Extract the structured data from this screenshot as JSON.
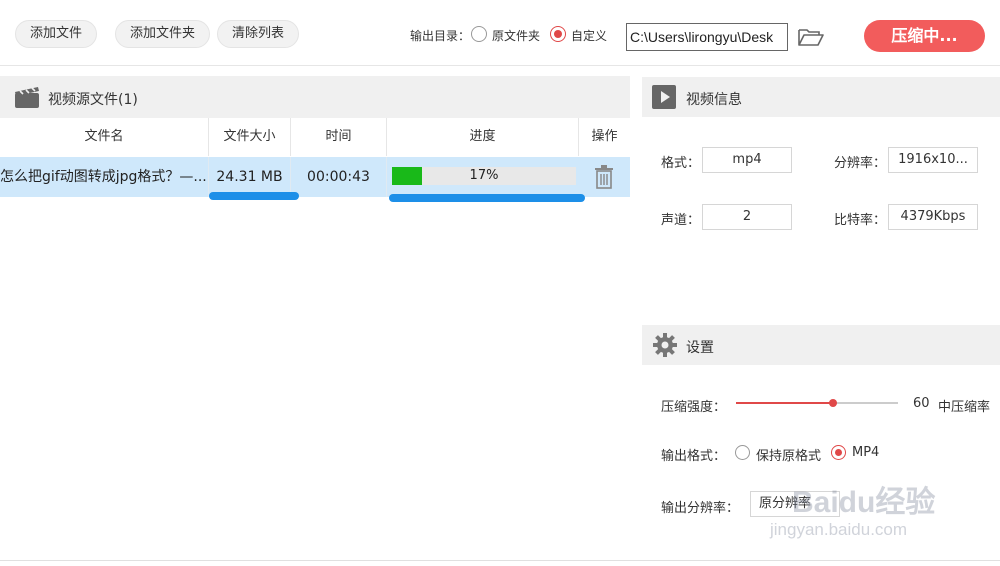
{
  "toolbar": {
    "add_file": "添加文件",
    "add_folder": "添加文件夹",
    "clear_list": "清除列表",
    "output_label": "输出目录：",
    "opt_source": "原文件夹",
    "opt_custom": "自定义",
    "output_path": "C:\\Users\\lirongyu\\Desk",
    "compress": "压缩中..."
  },
  "left": {
    "title": "视频源文件(1)",
    "columns": [
      "文件名",
      "文件大小",
      "时间",
      "进度",
      "操作"
    ],
    "rows": [
      {
        "name": "怎么把gif动图转成jpg格式？—...",
        "size": "24.31 MB",
        "time": "00:00:43",
        "progress_text": "17%",
        "progress": 0.17
      }
    ]
  },
  "video_info": {
    "title": "视频信息",
    "format_label": "格式：",
    "format": "mp4",
    "resolution_label": "分辨率：",
    "resolution": "1916x10...",
    "channel_label": "声道：",
    "channel": "2",
    "bitrate_label": "比特率：",
    "bitrate": "4379Kbps"
  },
  "settings": {
    "title": "设置",
    "strength_label": "压缩强度：",
    "strength_value": "60",
    "strength_level": 0.6,
    "strength_desc": "中压缩率",
    "format_label": "输出格式：",
    "opt_keep": "保持原格式",
    "opt_mp4": "MP4",
    "resolution_label": "输出分辨率：",
    "resolution_value": "原分辨率"
  },
  "watermark": {
    "brand": "Baidu经验",
    "url": "jingyan.baidu.com"
  },
  "colors": {
    "accent": "#e04848",
    "button_red": "#f25c5c",
    "selected_row": "#cfe8fb",
    "progress": "#19b919",
    "highlight": "#1d8fe8"
  }
}
